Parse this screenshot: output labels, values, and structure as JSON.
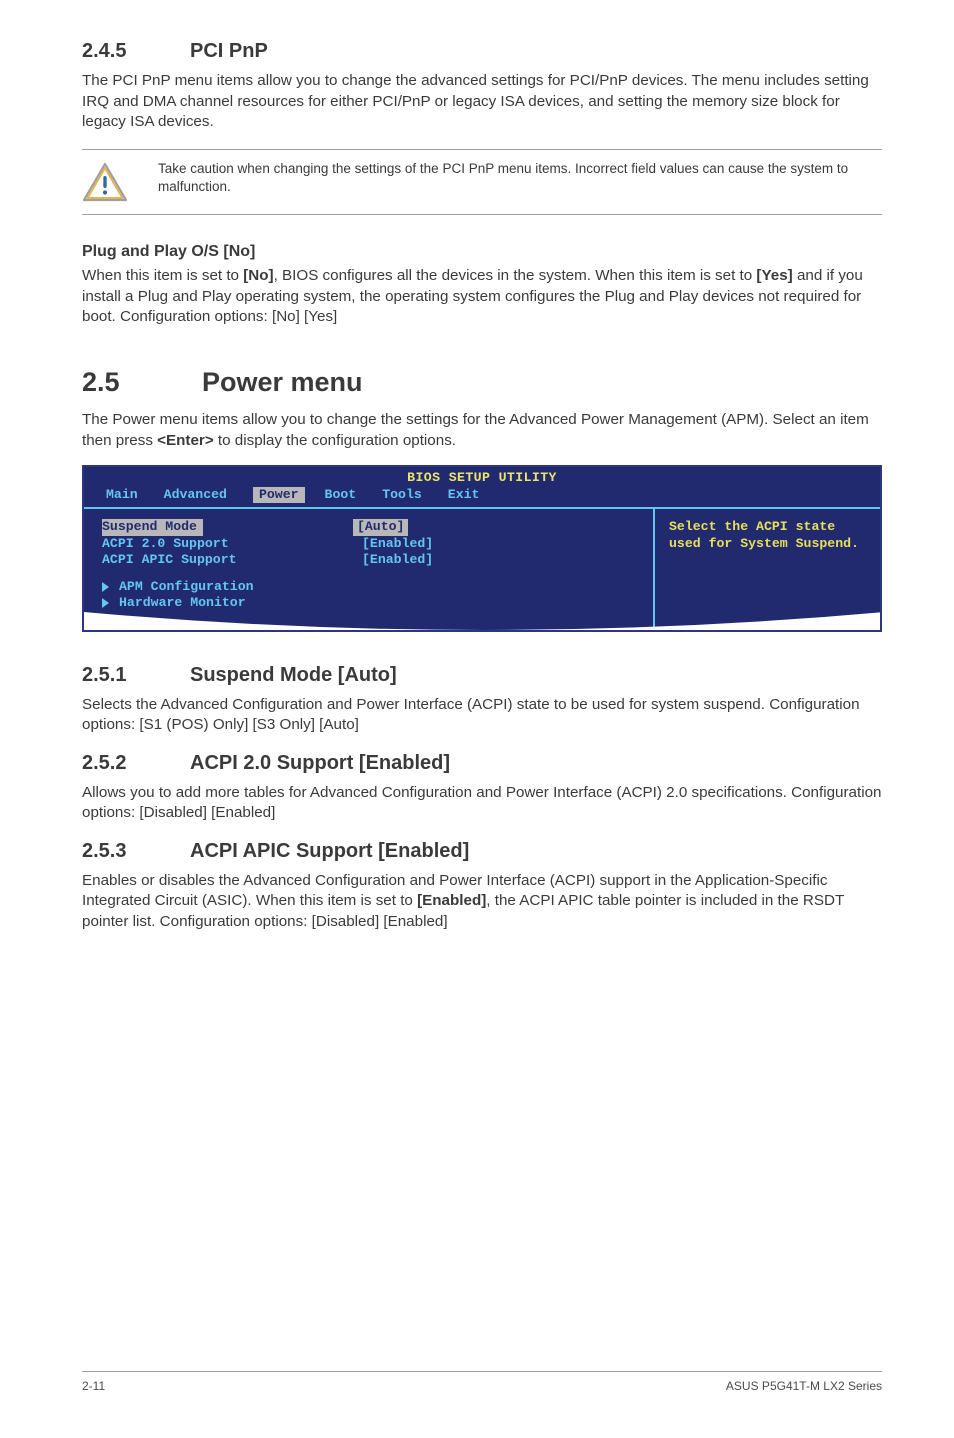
{
  "section_245": {
    "number": "2.4.5",
    "title": "PCI PnP",
    "paragraph": "The PCI PnP menu items allow you to change the advanced settings for PCI/PnP devices. The menu includes setting IRQ and DMA channel resources for either PCI/PnP or legacy ISA devices, and setting the memory size block for legacy ISA devices.",
    "callout": "Take caution when changing the settings of the PCI PnP menu items. Incorrect field values can cause the system to malfunction.",
    "sub_heading": "Plug and Play O/S [No]",
    "sub_text_pre": "When this item is set to ",
    "sub_text_bold1": "[No]",
    "sub_text_mid1": ", BIOS configures all the devices in the system. When this item is set to ",
    "sub_text_bold2": "[Yes]",
    "sub_text_mid2": " and if you install a Plug and Play operating system, the operating system configures the Plug and Play devices not required for boot. Configuration options: [No] [Yes]"
  },
  "section_25": {
    "number": "2.5",
    "title": "Power menu",
    "paragraph_pre": "The Power menu items allow you to change the settings for the Advanced Power Management (APM). Select an item then press ",
    "paragraph_bold": "<Enter>",
    "paragraph_post": " to display the configuration options."
  },
  "bios": {
    "title": "BIOS SETUP UTILITY",
    "tabs": [
      "Main",
      "Advanced",
      "Power",
      "Boot",
      "Tools",
      "Exit"
    ],
    "active_tab": "Power",
    "rows": [
      {
        "label": "Suspend Mode",
        "value": "[Auto]",
        "selected": true
      },
      {
        "label": "ACPI 2.0 Support",
        "value": "[Enabled]",
        "selected": false
      },
      {
        "label": "ACPI APIC Support",
        "value": "[Enabled]",
        "selected": false
      }
    ],
    "submenus": [
      "APM Configuration",
      "Hardware Monitor"
    ],
    "help": "Select the ACPI state used for System Suspend."
  },
  "section_251": {
    "number": "2.5.1",
    "title": "Suspend Mode [Auto]",
    "paragraph": "Selects the Advanced Configuration and Power Interface (ACPI) state to be used for system suspend. Configuration options: [S1 (POS) Only] [S3 Only] [Auto]"
  },
  "section_252": {
    "number": "2.5.2",
    "title": "ACPI 2.0 Support [Enabled]",
    "paragraph": "Allows you to add more tables for Advanced Configuration and Power Interface (ACPI) 2.0 specifications. Configuration options: [Disabled] [Enabled]"
  },
  "section_253": {
    "number": "2.5.3",
    "title": "ACPI APIC Support [Enabled]",
    "para_pre": "Enables or disables the Advanced Configuration and Power Interface (ACPI) support in the Application-Specific Integrated Circuit (ASIC). When this item is set to ",
    "para_bold": "[Enabled]",
    "para_post": ", the ACPI APIC table pointer is included in the RSDT pointer list. Configuration options: [Disabled] [Enabled]"
  },
  "footer": {
    "left": "2-11",
    "right": "ASUS P5G41T-M LX2 Series"
  }
}
